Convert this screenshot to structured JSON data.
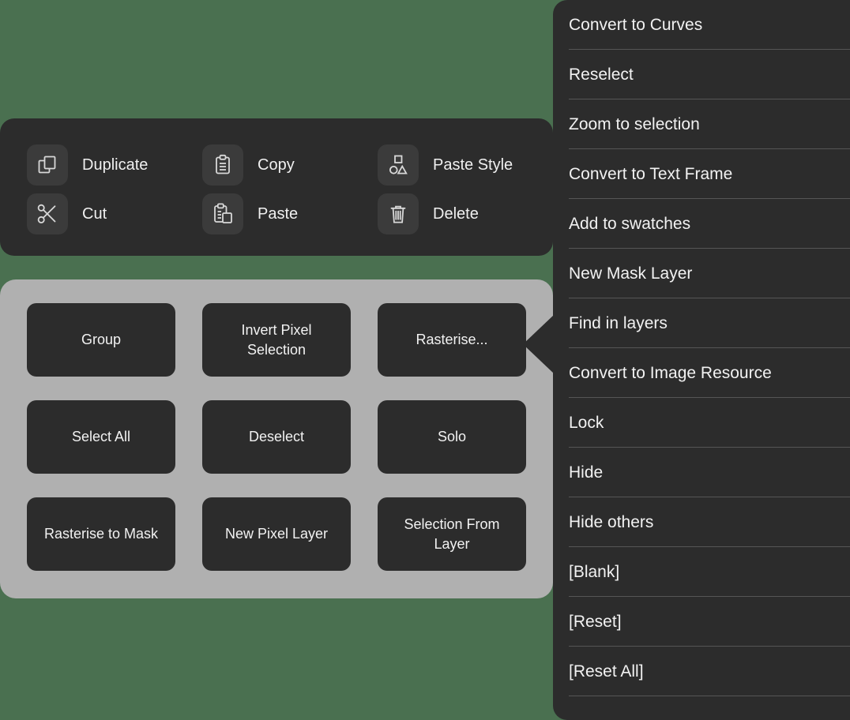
{
  "background_color": "#4a7050",
  "clipboard_panel": {
    "background_color": "#2c2c2c",
    "items": [
      {
        "label": "Duplicate",
        "icon": "duplicate-icon"
      },
      {
        "label": "Copy",
        "icon": "clipboard-copy-icon"
      },
      {
        "label": "Paste Style",
        "icon": "paste-style-shapes-icon"
      },
      {
        "label": "Cut",
        "icon": "scissors-icon"
      },
      {
        "label": "Paste",
        "icon": "clipboard-paste-icon"
      },
      {
        "label": "Delete",
        "icon": "trash-icon"
      }
    ]
  },
  "actions_panel": {
    "background_color": "#b0b0b0",
    "button_color": "#2c2c2c",
    "buttons": [
      {
        "label": "Group"
      },
      {
        "label": "Invert Pixel\nSelection"
      },
      {
        "label": "Rasterise..."
      },
      {
        "label": "Select All"
      },
      {
        "label": "Deselect"
      },
      {
        "label": "Solo"
      },
      {
        "label": "Rasterise to Mask"
      },
      {
        "label": "New Pixel Layer"
      },
      {
        "label": "Selection From\nLayer"
      }
    ]
  },
  "context_menu": {
    "background_color": "#2c2c2c",
    "divider_color": "#565656",
    "items": [
      {
        "label": "Convert to Curves"
      },
      {
        "label": "Reselect"
      },
      {
        "label": "Zoom to selection"
      },
      {
        "label": "Convert to Text Frame"
      },
      {
        "label": "Add to swatches"
      },
      {
        "label": "New Mask Layer"
      },
      {
        "label": "Find in layers"
      },
      {
        "label": "Convert to Image Resource"
      },
      {
        "label": "Lock"
      },
      {
        "label": "Hide"
      },
      {
        "label": "Hide others"
      },
      {
        "label": "[Blank]"
      },
      {
        "label": "[Reset]"
      },
      {
        "label": "[Reset All]"
      }
    ]
  }
}
